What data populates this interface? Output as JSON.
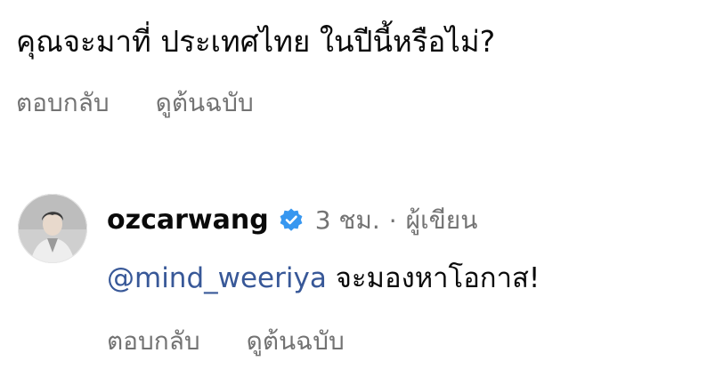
{
  "parent_comment": {
    "text": "คุณจะมาที่ ประเทศไทย ในปีนี้หรือไม่?",
    "actions": {
      "reply": "ตอบกลับ",
      "see_translation": "ดูต้นฉบับ"
    }
  },
  "reply": {
    "username": "ozcarwang",
    "verified_icon": "verified-badge-icon",
    "timestamp": "3 ชม.",
    "separator": "·",
    "author_tag": "ผู้เขียน",
    "mention": "@mind_weeriya",
    "text": " จะมองหาโอกาส!",
    "actions": {
      "reply": "ตอบกลับ",
      "see_translation": "ดูต้นฉบับ"
    }
  },
  "colors": {
    "secondary_text": "#737373",
    "mention": "#385898",
    "verified": "#3797f0"
  }
}
